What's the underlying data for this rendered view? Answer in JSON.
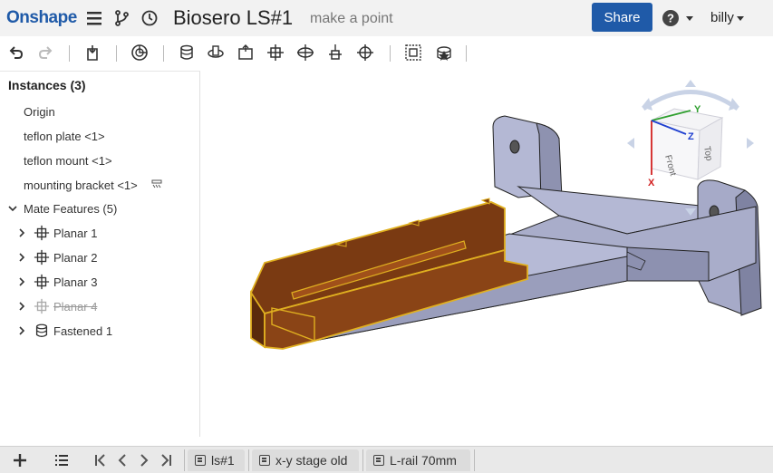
{
  "header": {
    "logo": "Onshape",
    "title": "Biosero LS#1",
    "subtitle": "make a point",
    "share_label": "Share",
    "user": "billy"
  },
  "panel": {
    "instances_header": "Instances (3)",
    "instances": [
      "Origin",
      "teflon plate <1>",
      "teflon mount <1>",
      "mounting bracket <1>"
    ],
    "mate_header": "Mate Features (5)",
    "mates": [
      {
        "label": "Planar 1"
      },
      {
        "label": "Planar 2"
      },
      {
        "label": "Planar 3"
      },
      {
        "label": "Planar 4"
      },
      {
        "label": "Fastened 1"
      }
    ]
  },
  "viewcube": {
    "x_label": "X",
    "y_label": "Y",
    "z_label": "Z",
    "front_label": "Front",
    "top_label": "Top",
    "x_color": "#d22020",
    "y_color": "#30a030",
    "z_color": "#2040d0"
  },
  "tabs": [
    "ls#1",
    "x-y stage old",
    "L-rail 70mm"
  ],
  "colors": {
    "brand": "#1f5aa8",
    "part_body": "#a9adca",
    "selected_part": "#7a3a12",
    "selection_outline": "#e0b020"
  }
}
